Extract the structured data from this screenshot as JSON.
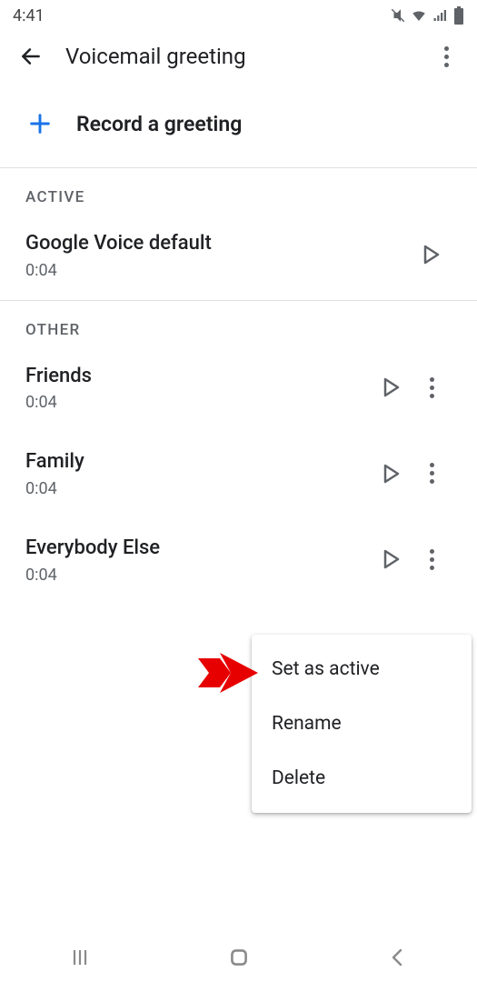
{
  "status": {
    "time": "4:41"
  },
  "appbar": {
    "title": "Voicemail greeting"
  },
  "record": {
    "label": "Record a greeting"
  },
  "sections": {
    "active_header": "ACTIVE",
    "other_header": "OTHER"
  },
  "active": {
    "name": "Google Voice default",
    "duration": "0:04"
  },
  "other": [
    {
      "name": "Friends",
      "duration": "0:04"
    },
    {
      "name": "Family",
      "duration": "0:04"
    },
    {
      "name": "Everybody Else",
      "duration": "0:04"
    }
  ],
  "menu": {
    "set_active": "Set as active",
    "rename": "Rename",
    "delete": "Delete"
  }
}
